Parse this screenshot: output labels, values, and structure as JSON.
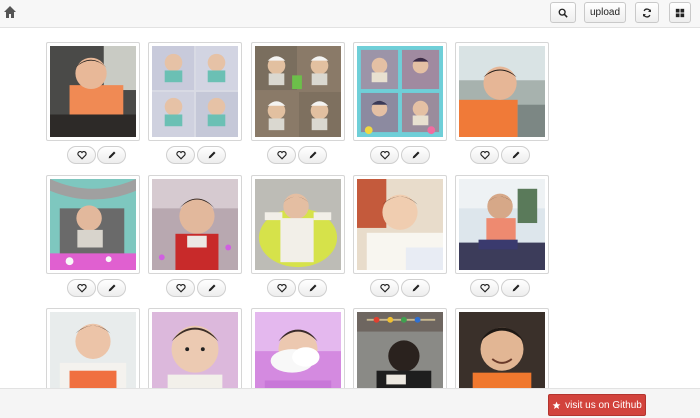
{
  "toolbar": {
    "home_icon": "home-icon",
    "search_icon": "search-icon",
    "upload_label": "upload",
    "refresh_icon": "refresh-icon",
    "grid_icon": "grid-view-icon"
  },
  "photos": [
    {
      "like_icon": "heart-icon",
      "edit_icon": "pencil-icon"
    },
    {
      "like_icon": "heart-icon",
      "edit_icon": "pencil-icon"
    },
    {
      "like_icon": "heart-icon",
      "edit_icon": "pencil-icon"
    },
    {
      "like_icon": "heart-icon",
      "edit_icon": "pencil-icon"
    },
    {
      "like_icon": "heart-icon",
      "edit_icon": "pencil-icon"
    },
    {
      "like_icon": "heart-icon",
      "edit_icon": "pencil-icon"
    },
    {
      "like_icon": "heart-icon",
      "edit_icon": "pencil-icon"
    },
    {
      "like_icon": "heart-icon",
      "edit_icon": "pencil-icon"
    },
    {
      "like_icon": "heart-icon",
      "edit_icon": "pencil-icon"
    },
    {
      "like_icon": "heart-icon",
      "edit_icon": "pencil-icon"
    },
    {
      "like_icon": "heart-icon",
      "edit_icon": "pencil-icon"
    },
    {
      "like_icon": "heart-icon",
      "edit_icon": "pencil-icon"
    },
    {
      "like_icon": "heart-icon",
      "edit_icon": "pencil-icon"
    },
    {
      "like_icon": "heart-icon",
      "edit_icon": "pencil-icon"
    },
    {
      "like_icon": "heart-icon",
      "edit_icon": "pencil-icon"
    }
  ],
  "footer": {
    "github_label": "visit us on Github",
    "star_icon": "star-icon"
  }
}
